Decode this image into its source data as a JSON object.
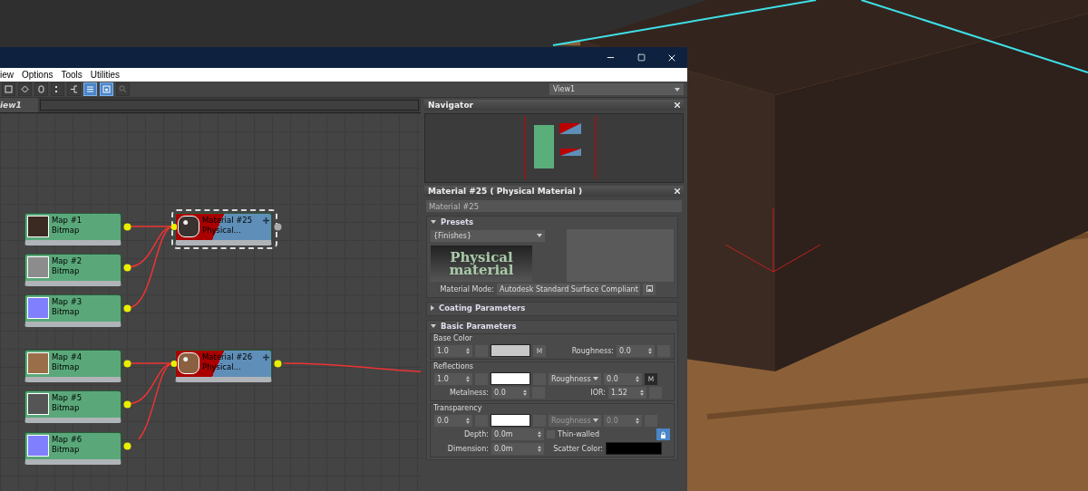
{
  "window": {
    "menu": [
      {
        "label": "iew"
      },
      {
        "label": "Options"
      },
      {
        "label": "Tools"
      },
      {
        "label": "Utilities"
      }
    ]
  },
  "toolbar": {
    "buttons": [
      {
        "kind": "square",
        "selected": false
      },
      {
        "kind": "target",
        "selected": false
      },
      {
        "kind": "zero",
        "selected": false
      },
      {
        "kind": "dots",
        "selected": false
      },
      {
        "kind": "branch",
        "selected": false
      },
      {
        "kind": "list",
        "selected": true
      },
      {
        "kind": "preview",
        "selected": true
      },
      {
        "kind": "magnifier",
        "selected": false
      }
    ],
    "view_select": "View1"
  },
  "view_tab": "iew1",
  "nodes": [
    {
      "kind": "map",
      "title": "Map #1",
      "subtitle": "Bitmap",
      "color": "#3b2a22"
    },
    {
      "kind": "map",
      "title": "Map #2",
      "subtitle": "Bitmap",
      "color": "#8c8c8c"
    },
    {
      "kind": "map",
      "title": "Map #3",
      "subtitle": "Bitmap",
      "color": "#8080ff"
    },
    {
      "kind": "map",
      "title": "Map #4",
      "subtitle": "Bitmap",
      "color": "#9a6e48"
    },
    {
      "kind": "map",
      "title": "Map #5",
      "subtitle": "Bitmap",
      "color": "#555555"
    },
    {
      "kind": "map",
      "title": "Map #6",
      "subtitle": "Bitmap",
      "color": "#8080ff"
    },
    {
      "kind": "material",
      "title": "Material #25",
      "subtitle": "Physical...",
      "color": "#3a3230",
      "selected": true
    },
    {
      "kind": "material",
      "title": "Material #26",
      "subtitle": "Physical...",
      "color": "#8a6040",
      "selected": false
    }
  ],
  "navigator": {
    "title": "Navigator"
  },
  "material_panel": {
    "title": "Material #25  ( Physical Material )",
    "name": "Material #25"
  },
  "presets": {
    "title": "Presets",
    "expanded": true,
    "preset": "{Finishes}",
    "logo_lines": [
      "Physical",
      "material"
    ],
    "mode_label": "Material Mode:",
    "mode": "Autodesk Standard Surface Compliant"
  },
  "coating": {
    "title": "Coating Parameters",
    "expanded": false
  },
  "basic": {
    "title": "Basic Parameters",
    "expanded": true,
    "base_color": {
      "title": "Base Color",
      "weight": "1.0",
      "map": "M",
      "roughness_label": "Roughness:",
      "roughness": "0.0"
    },
    "reflections": {
      "title": "Reflections",
      "weight": "1.0",
      "mode": "Roughness",
      "value": "0.0",
      "map": "M",
      "metalness_label": "Metalness:",
      "metalness": "0.0",
      "ior_label": "IOR:",
      "ior": "1.52"
    },
    "transparency": {
      "title": "Transparency",
      "weight": "0.0",
      "mode": "Roughness",
      "value": "0.0",
      "disabled": true,
      "depth_label": "Depth:",
      "depth": "0.0m",
      "thin_label": "Thin-walled",
      "thin_walled": false,
      "locked": true,
      "dimension_label": "Dimension:",
      "dimension": "0.0m",
      "scatter_label": "Scatter Color:"
    }
  }
}
